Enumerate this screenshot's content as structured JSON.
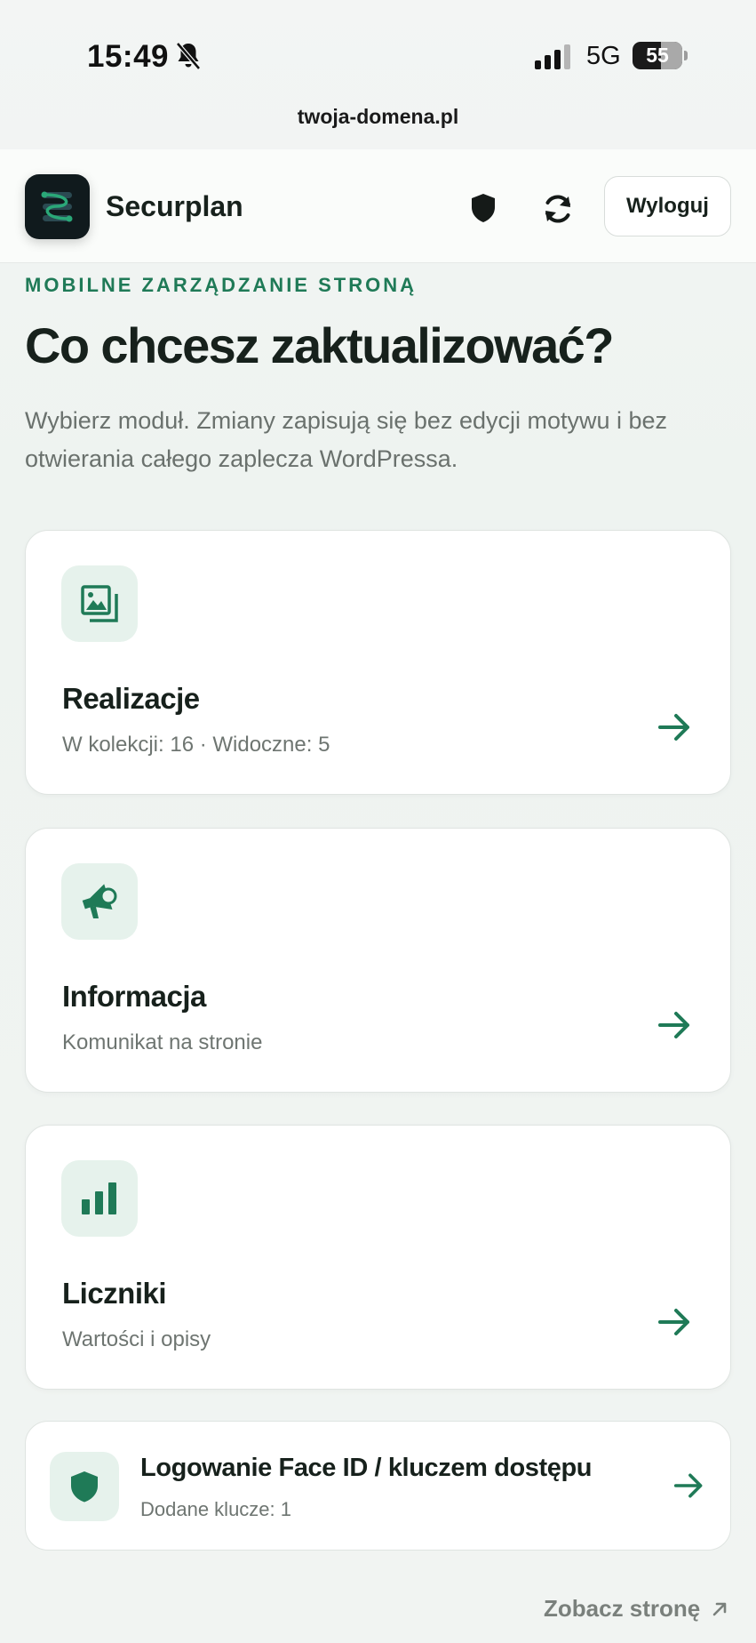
{
  "status_bar": {
    "time": "15:49",
    "network": "5G",
    "battery": "55"
  },
  "browser": {
    "url": "twoja-domena.pl"
  },
  "header": {
    "brand": "Securplan",
    "logout_label": "Wyloguj"
  },
  "intro": {
    "eyebrow": "MOBILNE ZARZĄDZANIE STRONĄ",
    "title": "Co chcesz zaktualizować?",
    "lead": "Wybierz moduł. Zmiany zapisują się bez edycji motywu i bez otwierania całego zaplecza WordPressa."
  },
  "modules": [
    {
      "title": "Realizacje",
      "subtitle": "W kolekcji: 16 · Widoczne: 5",
      "icon": "gallery-icon"
    },
    {
      "title": "Informacja",
      "subtitle": "Komunikat na stronie",
      "icon": "megaphone-icon"
    },
    {
      "title": "Liczniki",
      "subtitle": "Wartości i opisy",
      "icon": "bar-chart-icon"
    }
  ],
  "passkey": {
    "title": "Logowanie Face ID / kluczem dostępu",
    "subtitle": "Dodane klucze: 1",
    "icon": "shield-icon"
  },
  "footer": {
    "view_site_label": "Zobacz stronę"
  },
  "colors": {
    "accent": "#1f7a57",
    "icon_bg": "#e6f2ec",
    "text": "#17211c",
    "muted": "#6e7571"
  }
}
